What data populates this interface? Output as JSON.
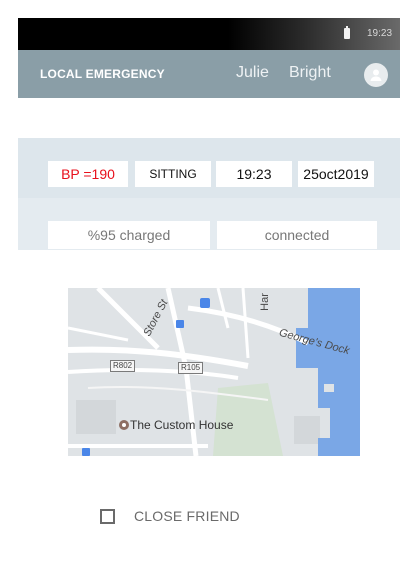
{
  "status_bar": {
    "time": "19:23"
  },
  "header": {
    "title": "LOCAL EMERGENCY",
    "user_first_name": "Julie",
    "user_last_name": "Bright",
    "avatar_icon": "person-icon"
  },
  "vitals": {
    "bp": "BP =190",
    "position": "SITTING",
    "time": "19:23",
    "date": "25oct2019"
  },
  "device_status": {
    "charge": "%95 charged",
    "connection": "connected"
  },
  "map": {
    "labels": {
      "store": "Store St",
      "har": "Har",
      "george": "George's Dock",
      "custom_house": "The Custom House",
      "r802": "R802",
      "r105": "R105"
    }
  },
  "close_friend": {
    "label": "CLOSE FRIEND",
    "checked": false
  },
  "colors": {
    "header_bg": "#8a9ea7",
    "bp_alert": "#e8101c",
    "water": "#7aa7e6"
  }
}
